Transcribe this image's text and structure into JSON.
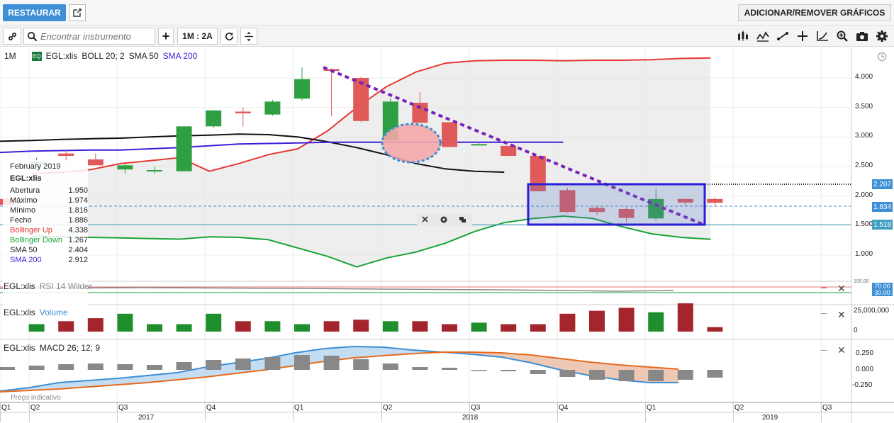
{
  "topbar": {
    "restore_label": "RESTAURAR",
    "addremove_label": "ADICIONAR/REMOVER GRÁFICOS"
  },
  "toolbar": {
    "search_placeholder": "Encontrar instrumento",
    "period_label": "1M : 2A",
    "plus_label": "+"
  },
  "main_pane": {
    "interval": "1M",
    "badge": "EQ",
    "symbol": "EGL:xlis",
    "boll": "BOLL 20; 2",
    "sma50": "SMA 50",
    "sma200": "SMA 200"
  },
  "legend": {
    "date": "February 2019",
    "symbol": "EGL:xlis",
    "rows": [
      {
        "label": "Abertura",
        "value": "1.950"
      },
      {
        "label": "Máximo",
        "value": "1.974"
      },
      {
        "label": "Mínimo",
        "value": "1.816"
      },
      {
        "label": "Fecho",
        "value": "1.886"
      },
      {
        "label": "Bollinger Up",
        "value": "4.338"
      },
      {
        "label": "Bollinger Down",
        "value": "1.267"
      },
      {
        "label": "SMA 50",
        "value": "2.404"
      },
      {
        "label": "SMA 200",
        "value": "2.912"
      }
    ]
  },
  "price_axis": {
    "ticks": [
      "4.000",
      "3.500",
      "3.000",
      "2.500",
      "2.000",
      "1.500",
      "1.000"
    ],
    "tags": [
      "2.207",
      "1.834",
      "1.518"
    ]
  },
  "rsi_pane": {
    "title": "EGL:xlis",
    "indicator": "RSI 14 Wilder",
    "tags": [
      "70.00",
      "30.00"
    ],
    "top": "100.00"
  },
  "volume_pane": {
    "title": "EGL:xlis",
    "indicator": "Volume",
    "ticks": [
      "25,000,000",
      "0"
    ]
  },
  "macd_pane": {
    "title": "EGL:xlis",
    "indicator": "MACD 26; 12; 9",
    "ticks": [
      "0.250",
      "0.000",
      "-0.250"
    ],
    "footer": "Preço indicativo"
  },
  "time_axis": {
    "quarters": [
      "Q1",
      "Q2",
      "Q3",
      "Q4",
      "Q1",
      "Q2",
      "Q3",
      "Q4",
      "Q1",
      "Q2",
      "Q3"
    ],
    "years": [
      "2017",
      "2018",
      "2019"
    ]
  },
  "colors": {
    "accent": "#3d8fd6",
    "up": "#2ea043",
    "down": "#e05a5a",
    "boll_up": "#e53935",
    "boll_down": "#1aa336",
    "sma50": "#111111",
    "sma200": "#3b1fd6",
    "vol_up": "#1f8f2e",
    "vol_down": "#a4262c",
    "annotation": "#2a1fd6"
  },
  "chart_data": [
    {
      "type": "candlestick",
      "title": "EGL:xlis",
      "x": [
        "2017-02",
        "2017-03",
        "2017-04",
        "2017-05",
        "2017-06",
        "2017-07",
        "2017-08",
        "2017-09",
        "2017-10",
        "2017-11",
        "2017-12",
        "2018-01",
        "2018-02",
        "2018-03",
        "2018-04",
        "2018-05",
        "2018-06",
        "2018-07",
        "2018-08",
        "2018-09",
        "2018-10",
        "2018-11",
        "2018-12",
        "2019-01",
        "2019-02"
      ],
      "ohlc": [
        [
          1.95,
          2.05,
          1.78,
          1.85
        ],
        [
          2.55,
          2.65,
          2.45,
          2.58
        ],
        [
          2.72,
          2.78,
          2.55,
          2.68
        ],
        [
          2.62,
          2.72,
          2.55,
          2.52
        ],
        [
          2.45,
          2.55,
          2.38,
          2.52
        ],
        [
          2.42,
          2.5,
          2.38,
          2.44
        ],
        [
          2.42,
          3.18,
          2.42,
          3.18
        ],
        [
          3.18,
          3.45,
          3.15,
          3.45
        ],
        [
          3.43,
          3.5,
          3.18,
          3.4
        ],
        [
          3.38,
          3.63,
          3.36,
          3.6
        ],
        [
          3.65,
          4.18,
          3.62,
          3.98
        ],
        [
          4.15,
          4.15,
          3.35,
          4.12
        ],
        [
          4.0,
          4.02,
          3.25,
          3.27
        ],
        [
          2.95,
          3.66,
          2.87,
          3.6
        ],
        [
          3.58,
          3.76,
          3.3,
          3.24
        ],
        [
          3.25,
          3.25,
          2.83,
          2.83
        ],
        [
          2.88,
          2.92,
          2.86,
          2.88
        ],
        [
          2.85,
          2.85,
          2.68,
          2.68
        ],
        [
          2.68,
          2.68,
          2.08,
          2.08
        ],
        [
          2.1,
          2.14,
          1.72,
          1.73
        ],
        [
          1.8,
          1.83,
          1.68,
          1.73
        ],
        [
          1.78,
          1.81,
          1.55,
          1.63
        ],
        [
          1.62,
          2.12,
          1.58,
          1.95
        ],
        [
          1.95,
          1.97,
          1.82,
          1.89
        ],
        [
          1.95,
          1.974,
          1.816,
          1.886
        ]
      ],
      "boll_up": [
        2.42,
        2.55,
        2.7,
        2.8,
        3.1,
        3.5,
        3.85,
        4.1,
        4.25,
        4.29,
        4.3,
        4.3,
        4.29,
        4.3,
        4.3,
        4.31,
        4.33,
        4.338
      ],
      "boll_down": [
        1.31,
        1.3,
        1.26,
        1.12,
        0.98,
        0.8,
        0.95,
        1.05,
        1.2,
        1.4,
        1.55,
        1.62,
        1.66,
        1.62,
        1.48,
        1.36,
        1.3,
        1.267
      ],
      "sma50": [
        2.98,
        3.0,
        3.02,
        3.03,
        3.05,
        3.04,
        3.0,
        2.92,
        2.82,
        2.7,
        2.55,
        2.46,
        2.42,
        2.404
      ],
      "sma200": [
        2.78,
        2.8,
        2.82,
        2.85,
        2.88,
        2.89,
        2.9,
        2.91,
        2.912
      ],
      "ylim": [
        0.7,
        4.4
      ]
    },
    {
      "type": "bar",
      "title": "Volume",
      "values": [
        5,
        7,
        9,
        12,
        5,
        5,
        12,
        7,
        7,
        5,
        7,
        8,
        7,
        7,
        5,
        6,
        5,
        5,
        12,
        14,
        16,
        13,
        19,
        3
      ],
      "ylim": [
        0,
        25000000
      ]
    },
    {
      "type": "bar",
      "title": "MACD 26; 12; 9",
      "values": [
        0.04,
        0.06,
        0.08,
        0.09,
        0.08,
        0.07,
        0.11,
        0.14,
        0.16,
        0.18,
        0.21,
        0.2,
        0.15,
        0.09,
        0.04,
        0.03,
        0,
        -0.02,
        -0.06,
        -0.1,
        -0.14,
        -0.16,
        -0.16,
        -0.14,
        -0.11
      ],
      "ylim": [
        -0.25,
        0.35
      ]
    }
  ]
}
